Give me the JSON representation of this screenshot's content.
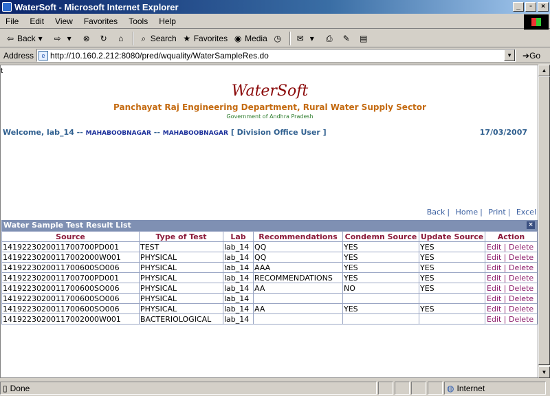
{
  "window": {
    "title": "WaterSoft - Microsoft Internet Explorer"
  },
  "menu": [
    "File",
    "Edit",
    "View",
    "Favorites",
    "Tools",
    "Help"
  ],
  "toolbar": {
    "back": "Back",
    "search": "Search",
    "favorites": "Favorites",
    "media": "Media"
  },
  "address": {
    "label": "Address",
    "url": "http://10.160.2.212:8080/pred/wquality/WaterSampleRes.do",
    "go": "Go"
  },
  "page": {
    "stray_char": "t",
    "brand": "WaterSoft",
    "department": "Panchayat Raj Engineering Department, Rural Water Supply Sector",
    "government": "Government of Andhra Pradesh",
    "welcome": "Welcome, lab_14 --",
    "district1": "MAHABOOBNAGAR",
    "sep": "--",
    "district2": "MAHABOOBNAGAR",
    "role": "[ Division Office User ]",
    "date": "17/03/2007",
    "links": {
      "back": "Back",
      "home": "Home",
      "print": "Print",
      "excel": "Excel"
    },
    "list_title": "Water Sample Test Result List",
    "columns": [
      "Source",
      "Type of Test",
      "Lab",
      "Recommendations",
      "Condemn Source",
      "Update Source",
      "Action"
    ],
    "rows": [
      [
        "1419223020011700700PD001",
        "TEST",
        "lab_14",
        "QQ",
        "YES",
        "YES"
      ],
      [
        "14192230200117002000W001",
        "PHYSICAL",
        "lab_14",
        "QQ",
        "YES",
        "YES"
      ],
      [
        "1419223020011700600SO006",
        "PHYSICAL",
        "lab_14",
        "AAA",
        "YES",
        "YES"
      ],
      [
        "1419223020011700700PD001",
        "PHYSICAL",
        "lab_14",
        "RECOMMENDATIONS",
        "YES",
        "YES"
      ],
      [
        "1419223020011700600SO006",
        "PHYSICAL",
        "lab_14",
        "AA",
        "NO",
        "YES"
      ],
      [
        "1419223020011700600SO006",
        "PHYSICAL",
        "lab_14",
        "",
        "",
        ""
      ],
      [
        "1419223020011700600SO006",
        "PHYSICAL",
        "lab_14",
        "AA",
        "YES",
        "YES"
      ],
      [
        "14192230200117002000W001",
        "BACTERIOLOGICAL",
        "lab_14",
        "",
        "",
        ""
      ]
    ],
    "edit_label": "Edit",
    "delete_label": "Delete"
  },
  "status": {
    "left": "Done",
    "zone": "Internet"
  }
}
